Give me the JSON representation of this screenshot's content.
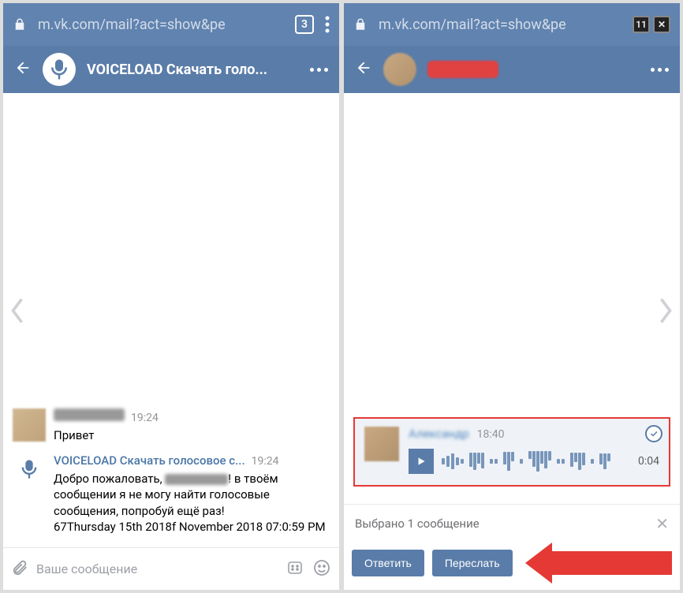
{
  "url": "m.vk.com/mail?act=show&pe",
  "tab_count": "3",
  "tab_count_alt": "11",
  "left": {
    "chat_title": "VOICELOAD Скачать голо...",
    "msg1": {
      "time": "19:24",
      "text": "Привет"
    },
    "msg2": {
      "name": "VOICELOAD Скачать голосовое с...",
      "time": "19:24",
      "line_a": "Добро пожаловать, ",
      "line_b": "! в твоём сообщении я не могу найти голосовые сообщения, попробуй ещё раз!",
      "line_c": "67Thursday 15th 2018f November 2018 07:0:59 PM"
    },
    "input_placeholder": "Ваше сообщение"
  },
  "right": {
    "voice": {
      "name": "Александр",
      "time": "18:40",
      "duration": "0:04"
    },
    "selection_info": "Выбрано 1 сообщение",
    "btn_reply": "Ответить",
    "btn_forward": "Переслать"
  }
}
